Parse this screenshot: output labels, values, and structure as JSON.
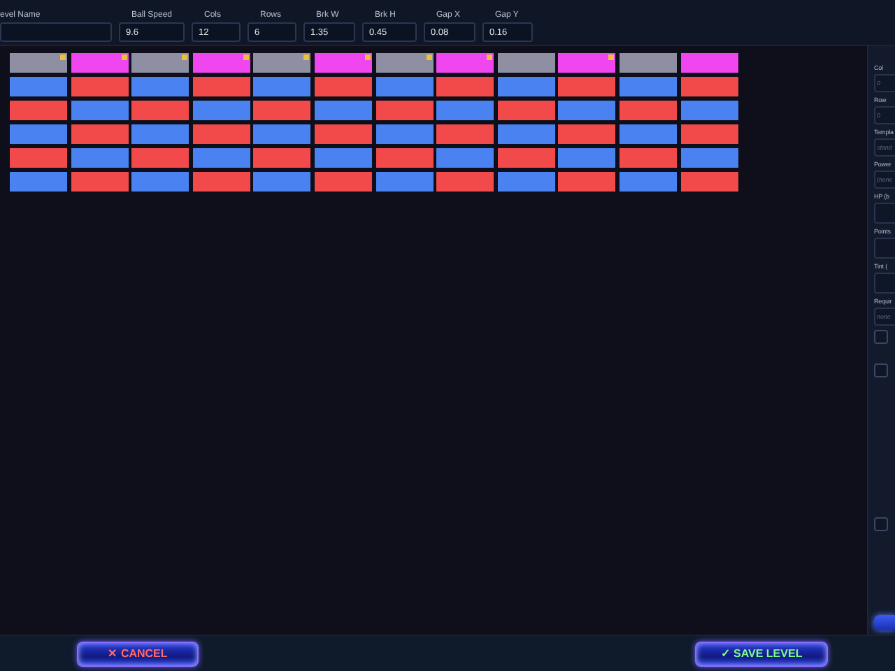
{
  "top_fields": [
    {
      "label": "evel Name"
    },
    {
      "label": "Ball Speed",
      "value": "9.6"
    },
    {
      "label": "Cols",
      "value": "12"
    },
    {
      "label": "Rows",
      "value": "6"
    },
    {
      "label": "Brk W",
      "value": "1.35"
    },
    {
      "label": "Brk H",
      "value": "0.45"
    },
    {
      "label": "Gap X",
      "value": "0.08"
    },
    {
      "label": "Gap Y",
      "value": "0.16"
    }
  ],
  "bricks": [
    [
      {
        "color": "#8f8fa3",
        "flagged": true
      },
      {
        "color": "#f046ef",
        "flagged": true
      },
      {
        "color": "#8f8fa3",
        "flagged": true
      },
      {
        "color": "#f046ef",
        "flagged": true
      },
      {
        "color": "#8f8fa3",
        "flagged": true
      },
      {
        "color": "#f046ef",
        "flagged": true
      },
      {
        "color": "#8f8fa3",
        "flagged": true
      },
      {
        "color": "#f046ef",
        "flagged": true
      },
      {
        "color": "#8f8fa3",
        "flagged": false
      },
      {
        "color": "#f046ef",
        "flagged": true
      },
      {
        "color": "#8f8fa3",
        "flagged": false
      },
      {
        "color": "#f046ef",
        "flagged": false
      }
    ],
    [
      {
        "color": "#4a82f2",
        "flagged": false
      },
      {
        "color": "#f24a4a",
        "flagged": false
      },
      {
        "color": "#4a82f2",
        "flagged": false
      },
      {
        "color": "#f24a4a",
        "flagged": false
      },
      {
        "color": "#4a82f2",
        "flagged": false
      },
      {
        "color": "#f24a4a",
        "flagged": false
      },
      {
        "color": "#4a82f2",
        "flagged": false
      },
      {
        "color": "#f24a4a",
        "flagged": false
      },
      {
        "color": "#4a82f2",
        "flagged": false
      },
      {
        "color": "#f24a4a",
        "flagged": false
      },
      {
        "color": "#4a82f2",
        "flagged": false
      },
      {
        "color": "#f24a4a",
        "flagged": false
      }
    ],
    [
      {
        "color": "#f24a4a",
        "flagged": false
      },
      {
        "color": "#4a82f2",
        "flagged": false
      },
      {
        "color": "#f24a4a",
        "flagged": false
      },
      {
        "color": "#4a82f2",
        "flagged": false
      },
      {
        "color": "#f24a4a",
        "flagged": false
      },
      {
        "color": "#4a82f2",
        "flagged": false
      },
      {
        "color": "#f24a4a",
        "flagged": false
      },
      {
        "color": "#4a82f2",
        "flagged": false
      },
      {
        "color": "#f24a4a",
        "flagged": false
      },
      {
        "color": "#4a82f2",
        "flagged": false
      },
      {
        "color": "#f24a4a",
        "flagged": false
      },
      {
        "color": "#4a82f2",
        "flagged": false
      }
    ],
    [
      {
        "color": "#4a82f2",
        "flagged": false
      },
      {
        "color": "#f24a4a",
        "flagged": false
      },
      {
        "color": "#4a82f2",
        "flagged": false
      },
      {
        "color": "#f24a4a",
        "flagged": false
      },
      {
        "color": "#4a82f2",
        "flagged": false
      },
      {
        "color": "#f24a4a",
        "flagged": false
      },
      {
        "color": "#4a82f2",
        "flagged": false
      },
      {
        "color": "#f24a4a",
        "flagged": false
      },
      {
        "color": "#4a82f2",
        "flagged": false
      },
      {
        "color": "#f24a4a",
        "flagged": false
      },
      {
        "color": "#4a82f2",
        "flagged": false
      },
      {
        "color": "#f24a4a",
        "flagged": false
      }
    ],
    [
      {
        "color": "#f24a4a",
        "flagged": false
      },
      {
        "color": "#4a82f2",
        "flagged": false
      },
      {
        "color": "#f24a4a",
        "flagged": false
      },
      {
        "color": "#4a82f2",
        "flagged": false
      },
      {
        "color": "#f24a4a",
        "flagged": false
      },
      {
        "color": "#4a82f2",
        "flagged": false
      },
      {
        "color": "#f24a4a",
        "flagged": false
      },
      {
        "color": "#4a82f2",
        "flagged": false
      },
      {
        "color": "#f24a4a",
        "flagged": false
      },
      {
        "color": "#4a82f2",
        "flagged": false
      },
      {
        "color": "#f24a4a",
        "flagged": false
      },
      {
        "color": "#4a82f2",
        "flagged": false
      }
    ],
    [
      {
        "color": "#4a82f2",
        "flagged": false
      },
      {
        "color": "#f24a4a",
        "flagged": false
      },
      {
        "color": "#4a82f2",
        "flagged": false
      },
      {
        "color": "#f24a4a",
        "flagged": false
      },
      {
        "color": "#4a82f2",
        "flagged": false
      },
      {
        "color": "#f24a4a",
        "flagged": false
      },
      {
        "color": "#4a82f2",
        "flagged": false
      },
      {
        "color": "#f24a4a",
        "flagged": false
      },
      {
        "color": "#4a82f2",
        "flagged": false
      },
      {
        "color": "#f24a4a",
        "flagged": false
      },
      {
        "color": "#4a82f2",
        "flagged": false
      },
      {
        "color": "#f24a4a",
        "flagged": false
      }
    ]
  ],
  "side_panel": {
    "fields": [
      {
        "label": "Col",
        "placeholder": "0"
      },
      {
        "label": "Row",
        "placeholder": "0"
      },
      {
        "label": "Templa",
        "placeholder": "stand"
      },
      {
        "label": "Power",
        "placeholder": "(none"
      },
      {
        "label": "HP (b"
      },
      {
        "label": "Points"
      },
      {
        "label": "Tint ("
      },
      {
        "label": "Requir",
        "placeholder": "none"
      }
    ],
    "checkboxes": [
      {
        "checked": false
      },
      {
        "checked": false
      },
      {
        "checked": false
      }
    ]
  },
  "footer": {
    "buttons": [
      {
        "label": "✕ CANCEL",
        "kind": "cancel"
      },
      {
        "label": "✓ SAVE LEVEL",
        "kind": "save"
      }
    ]
  }
}
